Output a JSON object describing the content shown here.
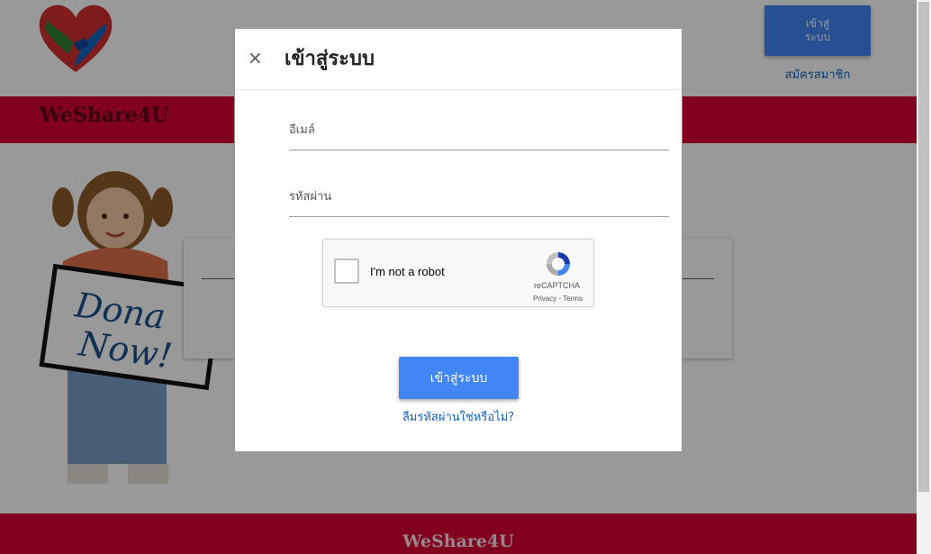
{
  "header": {
    "login_button": "เข้าสู่\nระบบ",
    "signup_link": "สมัครสมาชิก",
    "brand": "WeShare4U"
  },
  "hero": {
    "sign_text_line1": "Dona",
    "sign_text_line2": "Now!"
  },
  "footer": {
    "brand": "WeShare4U"
  },
  "modal": {
    "close_symbol": "×",
    "title": "เข้าสู่ระบบ",
    "email_label": "อีเมล์",
    "password_label": "รหัสผ่าน",
    "recaptcha": {
      "checkbox_text": "I'm not a robot",
      "brand": "reCAPTCHA",
      "links": "Privacy - Terms"
    },
    "submit_label": "เข้าสู่ระบบ",
    "forgot_link": "ลืมรหัสผ่านใช่หรือไม่?"
  },
  "colors": {
    "nav_red": "#d50032",
    "button_blue": "#4285f4",
    "link_blue": "#1565c0",
    "overlay": "rgba(0,0,0,0.4)"
  }
}
